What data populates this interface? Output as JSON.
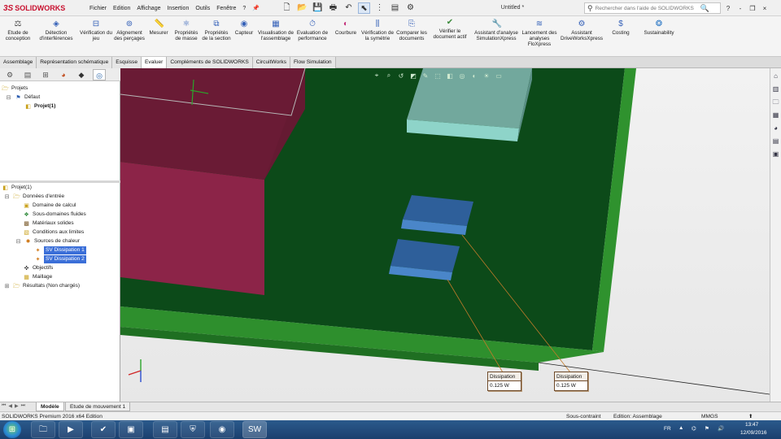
{
  "titlebar": {
    "logo": "SOLIDWORKS",
    "menu": [
      "Fichier",
      "Edition",
      "Affichage",
      "Insertion",
      "Outils",
      "Fenêtre",
      "?"
    ],
    "doc_title": "Untitled *",
    "search_placeholder": "Rechercher dans l'aide de SOLIDWORKS",
    "win_controls": [
      "?",
      "-",
      "❐",
      "×"
    ]
  },
  "ribbon": {
    "buttons": [
      {
        "id": "etude",
        "label": "Etude de conception",
        "icon": "design-study-icon"
      },
      {
        "id": "interferences",
        "label": "Détection d'interférences",
        "icon": "interference-icon"
      },
      {
        "id": "jeu",
        "label": "Vérification du jeu",
        "icon": "clearance-icon"
      },
      {
        "id": "percages",
        "label": "Alignement des perçages",
        "icon": "hole-alignment-icon"
      },
      {
        "id": "mesurer",
        "label": "Mesurer",
        "icon": "measure-icon"
      },
      {
        "id": "masse",
        "label": "Propriétés de masse",
        "icon": "mass-properties-icon"
      },
      {
        "id": "section",
        "label": "Propriétés de la section",
        "icon": "section-properties-icon"
      },
      {
        "id": "capteur",
        "label": "Capteur",
        "icon": "sensor-icon"
      },
      {
        "id": "visualisation",
        "label": "Visualisation de l'assemblage",
        "icon": "assembly-visualization-icon"
      },
      {
        "id": "performance",
        "label": "Evaluation de performance",
        "icon": "performance-icon"
      },
      {
        "id": "courbure",
        "label": "Courbure",
        "icon": "curvature-icon"
      },
      {
        "id": "symetrie",
        "label": "Vérification de la symétrie",
        "icon": "symmetry-icon"
      },
      {
        "id": "comparer",
        "label": "Comparer les documents",
        "icon": "compare-icon"
      },
      {
        "id": "verifier",
        "label": "Vérifier le document actif",
        "icon": "check-document-icon"
      },
      {
        "id": "simxpress",
        "label": "Assistant d'analyse SimulationXpress",
        "icon": "simulationxpress-icon"
      },
      {
        "id": "floxpress",
        "label": "Lancement des analyses FloXpress",
        "icon": "floxpress-icon"
      },
      {
        "id": "driveworks",
        "label": "Assistant DriveWorksXpress",
        "icon": "driveworks-icon"
      },
      {
        "id": "costing",
        "label": "Costing",
        "icon": "costing-icon"
      },
      {
        "id": "sustainability",
        "label": "Sustainability",
        "icon": "sustainability-icon"
      }
    ]
  },
  "tabs": [
    {
      "label": "Assemblage",
      "active": false
    },
    {
      "label": "Représentation schématique",
      "active": false
    },
    {
      "label": "Esquisse",
      "active": false
    },
    {
      "label": "Evaluer",
      "active": true
    },
    {
      "label": "Compléments de SOLIDWORKS",
      "active": false
    },
    {
      "label": "CircuitWorks",
      "active": false
    },
    {
      "label": "Flow Simulation",
      "active": false
    }
  ],
  "tree_top": [
    {
      "label": "Projets",
      "level": 0,
      "bold": false,
      "icon": "projects-icon"
    },
    {
      "label": "Défaut",
      "level": 1,
      "bold": false,
      "icon": "configuration-icon"
    },
    {
      "label": "Projet(1)",
      "level": 2,
      "bold": true,
      "icon": "project-icon"
    }
  ],
  "tree_bottom": [
    {
      "label": "Projet(1)",
      "level": 0,
      "sel": false,
      "icon": "project-icon"
    },
    {
      "label": "Données d'entrée",
      "level": 1,
      "sel": false,
      "icon": "input-data-icon"
    },
    {
      "label": "Domaine de calcul",
      "level": 2,
      "sel": false,
      "icon": "computational-domain-icon"
    },
    {
      "label": "Sous-domaines fluides",
      "level": 2,
      "sel": false,
      "icon": "fluid-subdomain-icon"
    },
    {
      "label": "Matériaux solides",
      "level": 2,
      "sel": false,
      "icon": "solid-materials-icon"
    },
    {
      "label": "Conditions aux limites",
      "level": 2,
      "sel": false,
      "icon": "boundary-conditions-icon"
    },
    {
      "label": "Sources de chaleur",
      "level": 2,
      "sel": false,
      "icon": "heat-sources-icon"
    },
    {
      "label": "SV Dissipation 1",
      "level": 3,
      "sel": true,
      "icon": "volume-source-icon"
    },
    {
      "label": "SV Dissipation 2",
      "level": 3,
      "sel": true,
      "icon": "volume-source-icon"
    },
    {
      "label": "Objectifs",
      "level": 2,
      "sel": false,
      "icon": "goals-icon"
    },
    {
      "label": "Maillage",
      "level": 2,
      "sel": false,
      "icon": "mesh-icon"
    },
    {
      "label": "Résultats (Non chargés)",
      "level": 1,
      "sel": false,
      "icon": "results-icon"
    }
  ],
  "callouts": [
    {
      "title": "Dissipation",
      "value": "0.125 W"
    },
    {
      "title": "Dissipation",
      "value": "0.125 W"
    }
  ],
  "model_tabs": [
    {
      "label": "Modèle",
      "active": true
    },
    {
      "label": "Etude de mouvement 1",
      "active": false
    }
  ],
  "status": {
    "edition": "SOLIDWORKS Premium 2016 x64 Edition",
    "constraint": "Sous-contraint",
    "mode": "Edition: Assemblage",
    "units": "MMGS"
  },
  "taskbar": {
    "lang": "FR",
    "time": "13:47",
    "date": "12/09/2016"
  },
  "colors": {
    "board": "#0b4b19",
    "board_edge": "#2c8f2a",
    "enclosure": "#8c2448",
    "chip": "#3c6da8",
    "heatsink": "#7fbeb5",
    "selection": "#3b6fd8"
  }
}
